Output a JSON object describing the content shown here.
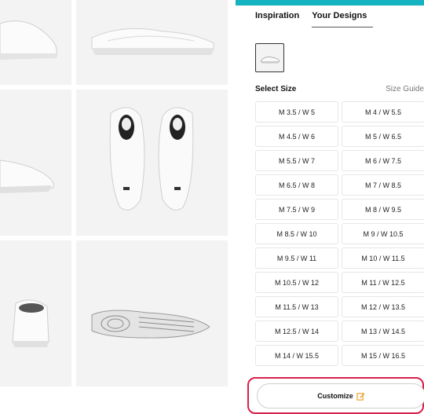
{
  "panel": {
    "tabs": [
      {
        "label": "Inspiration",
        "active": false
      },
      {
        "label": "Your Designs",
        "active": true
      }
    ],
    "select_size_label": "Select Size",
    "size_guide_label": "Size Guide",
    "sizes": [
      "M 3.5 / W 5",
      "M 4 / W 5.5",
      "M 4.5 / W 6",
      "M 5 / W 6.5",
      "M 5.5 / W 7",
      "M 6 / W 7.5",
      "M 6.5 / W 8",
      "M 7 / W 8.5",
      "M 7.5 / W 9",
      "M 8 / W 9.5",
      "M 8.5 / W 10",
      "M 9 / W 10.5",
      "M 9.5 / W 11",
      "M 10 / W 11.5",
      "M 10.5 / W 12",
      "M 11 / W 12.5",
      "M 11.5 / W 13",
      "M 12 / W 13.5",
      "M 12.5 / W 14",
      "M 13 / W 14.5",
      "M 14 / W 15.5",
      "M 15 / W 16.5"
    ],
    "customize_label": "Customize"
  },
  "colors": {
    "top_bar": "#15b3bf",
    "highlight_border": "#d6224a",
    "edit_icon": "#e89a1c"
  }
}
